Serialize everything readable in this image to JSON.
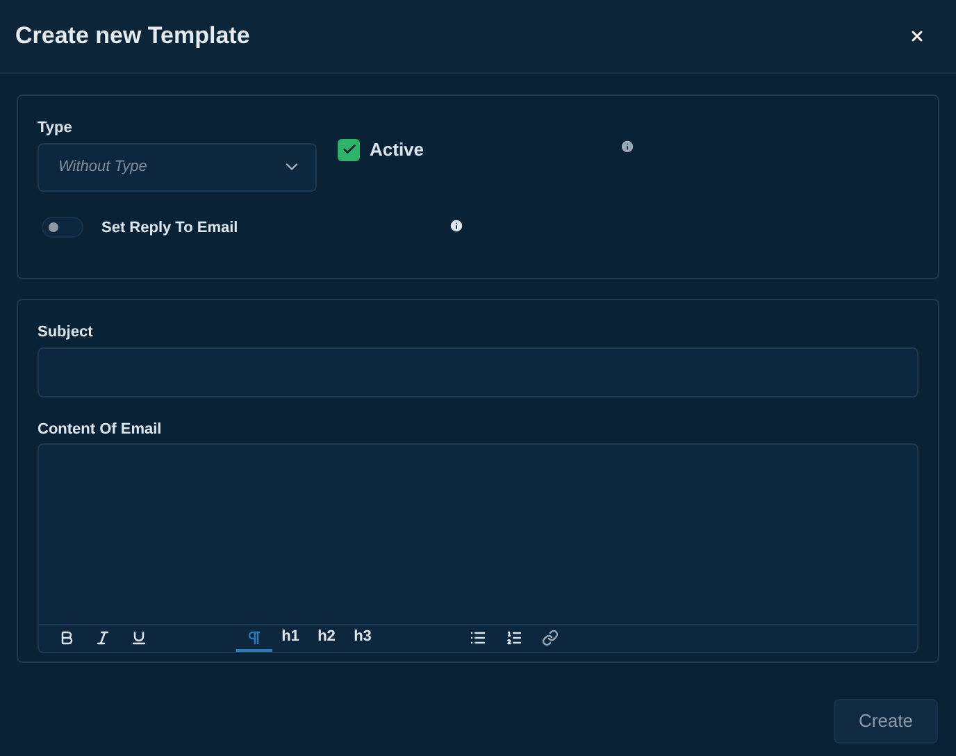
{
  "title": "Create new Template",
  "type_field": {
    "label": "Type",
    "placeholder": "Without Type"
  },
  "active": {
    "label": "Active",
    "checked": true
  },
  "reply_to_email": {
    "label": "Set Reply To Email",
    "on": false
  },
  "subject": {
    "label": "Subject"
  },
  "content": {
    "label": "Content Of Email"
  },
  "toolbar": [
    {
      "kind": "bold",
      "selected": false
    },
    {
      "kind": "italic",
      "selected": false
    },
    {
      "kind": "underline",
      "selected": false
    },
    {
      "kind": "paragraph",
      "selected": true
    },
    {
      "kind": "heading",
      "label": "h1",
      "selected": false
    },
    {
      "kind": "heading",
      "label": "h2",
      "selected": false
    },
    {
      "kind": "heading",
      "label": "h3",
      "selected": false
    },
    {
      "kind": "bullet-list",
      "selected": false
    },
    {
      "kind": "numbered-list",
      "selected": false
    },
    {
      "kind": "link",
      "selected": false
    }
  ],
  "create_button": {
    "label": "Create",
    "disabled": true
  }
}
